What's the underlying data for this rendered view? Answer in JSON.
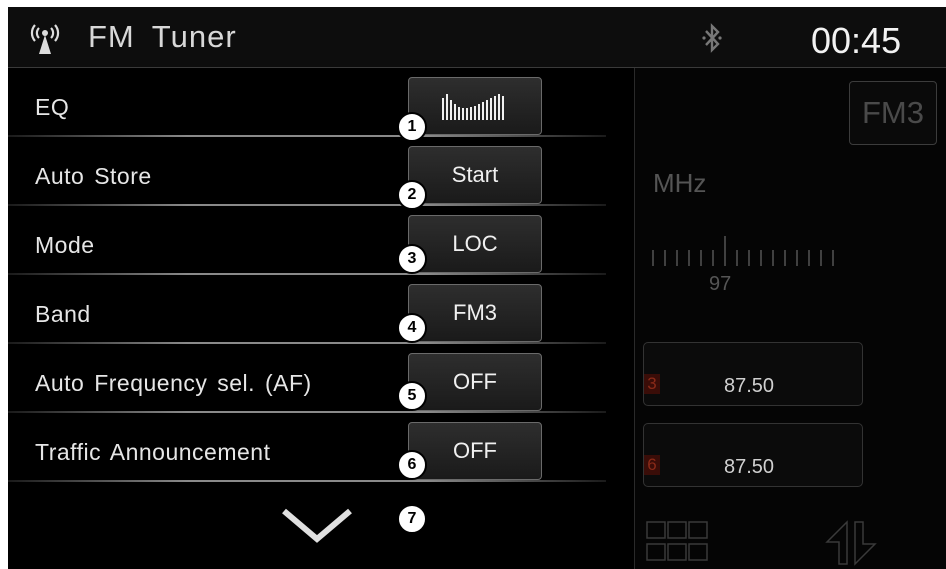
{
  "header": {
    "title": "FM  Tuner",
    "time": "00:45",
    "antenna_icon": "antenna-icon",
    "bluetooth_icon": "bluetooth-icon"
  },
  "settings": [
    {
      "label": "EQ",
      "value": "",
      "value_icon": "equalizer-bars-icon",
      "marker": "1"
    },
    {
      "label": "Auto  Store",
      "value": "Start",
      "marker": "2"
    },
    {
      "label": "Mode",
      "value": "LOC",
      "marker": "3"
    },
    {
      "label": "Band",
      "value": "FM3",
      "marker": "4"
    },
    {
      "label": "Auto  Frequency  sel. (AF)",
      "value": "OFF",
      "marker": "5"
    },
    {
      "label": "Traffic  Announcement",
      "value": "OFF",
      "marker": "6"
    }
  ],
  "more": {
    "icon": "chevron-down-icon",
    "marker": "7"
  },
  "radio": {
    "band": "FM3",
    "unit": "MHz",
    "scale_label": "97",
    "presets": [
      {
        "number": "3",
        "frequency": "87.50"
      },
      {
        "number": "6",
        "frequency": "87.50"
      }
    ],
    "grid_icon": "preset-grid-icon",
    "arrows_icon": "seek-arrows-icon"
  },
  "colors": {
    "background": "#000000",
    "text": "#e6e6e6",
    "accent": "#8a2a18"
  }
}
